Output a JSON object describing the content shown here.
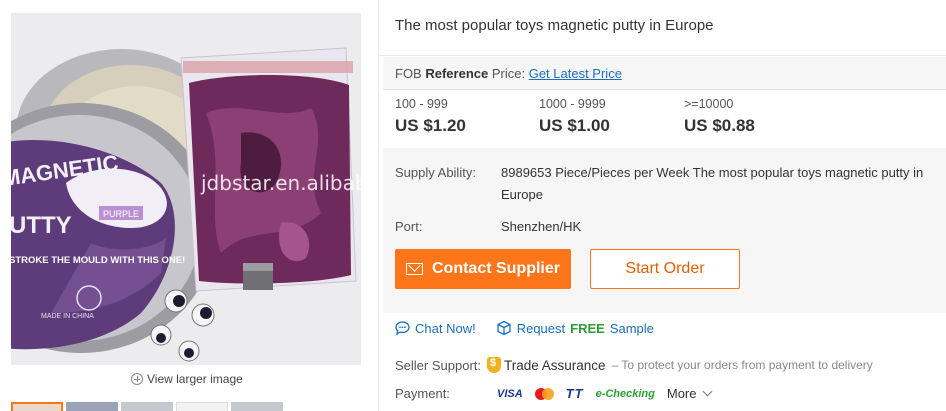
{
  "gallery": {
    "watermark": "jdbstar.en.alibaba.com",
    "view_larger_label": "View larger image",
    "product_tin_text": {
      "brand_1": "MAGNETIC",
      "brand_2": "PUTTY",
      "tag": "PURPLE",
      "tagline": "STROKE THE MOULD WITH THIS ONE!",
      "made_in": "MADE IN CHINA"
    }
  },
  "product": {
    "title": "The most popular toys magnetic putty in Europe"
  },
  "pricing": {
    "fob_prefix": "FOB",
    "fob_bold": "Reference",
    "fob_suffix": "Price:",
    "fob_link": "Get Latest Price",
    "tiers": [
      {
        "qty": "100 - 999",
        "price": "US $1.20"
      },
      {
        "qty": "1000 - 9999",
        "price": "US $1.00"
      },
      {
        "qty": ">=10000",
        "price": "US $0.88"
      }
    ],
    "supply_label": "Supply Ability:",
    "supply_value": "8989653 Piece/Pieces per Week The most popular toys magnetic putty in Europe",
    "port_label": "Port:",
    "port_value": "Shenzhen/HK",
    "contact_button": "Contact Supplier",
    "order_button": "Start Order"
  },
  "actions": {
    "chat_label": "Chat Now!",
    "request_prefix": "Request",
    "request_free": "FREE",
    "request_suffix": "Sample"
  },
  "seller_support": {
    "label": "Seller Support:",
    "trade_assurance": "Trade Assurance",
    "trade_desc": "– To protect your orders from payment to delivery"
  },
  "payment": {
    "label": "Payment:",
    "methods": [
      "VISA",
      "MasterCard",
      "TT",
      "e-Checking"
    ],
    "more_label": "More"
  },
  "colors": {
    "accent": "#ff7519",
    "link": "#1a6fbf",
    "free": "#2e9e34"
  }
}
